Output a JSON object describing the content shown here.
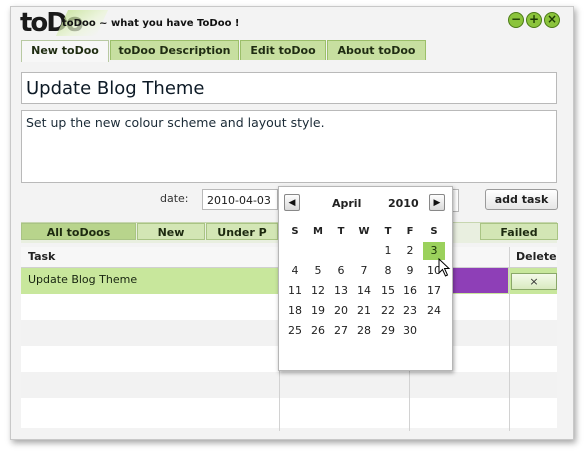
{
  "window": {
    "logo": "toDo",
    "title": "toDoo ~ what you have ToDoo !",
    "controls": [
      "−",
      "+",
      "×"
    ]
  },
  "tabs": [
    "New toDoo",
    "toDoo Description",
    "Edit toDoo",
    "About toDoo"
  ],
  "form": {
    "title_value": "Update Blog Theme",
    "description_value": "Set up the new colour scheme and layout style.",
    "date_label": "date:",
    "date_value": "2010-04-03",
    "add_button": "add task"
  },
  "filters": [
    "All toDoos",
    "New",
    "Under P",
    "Failed"
  ],
  "grid": {
    "columns": [
      "Task",
      "Delete"
    ],
    "rows": [
      {
        "task": "Update Blog Theme",
        "delete": "×"
      }
    ]
  },
  "calendar": {
    "month": "April",
    "year": "2010",
    "prev": "◀",
    "next": "▶",
    "dow": [
      "S",
      "M",
      "T",
      "W",
      "T",
      "F",
      "S"
    ],
    "weeks": [
      [
        "",
        "",
        "",
        "",
        "1",
        "2",
        "3"
      ],
      [
        "4",
        "5",
        "6",
        "7",
        "8",
        "9",
        "10"
      ],
      [
        "11",
        "12",
        "13",
        "14",
        "15",
        "16",
        "17"
      ],
      [
        "18",
        "19",
        "20",
        "21",
        "22",
        "23",
        "24"
      ],
      [
        "25",
        "26",
        "27",
        "28",
        "29",
        "30",
        ""
      ]
    ],
    "selected": "3"
  },
  "colors": {
    "tab": "#c7dfa0",
    "highlight_row": "#c8e79c",
    "status_purple": "#8e3fb7",
    "selected_day": "#9bd15c"
  }
}
